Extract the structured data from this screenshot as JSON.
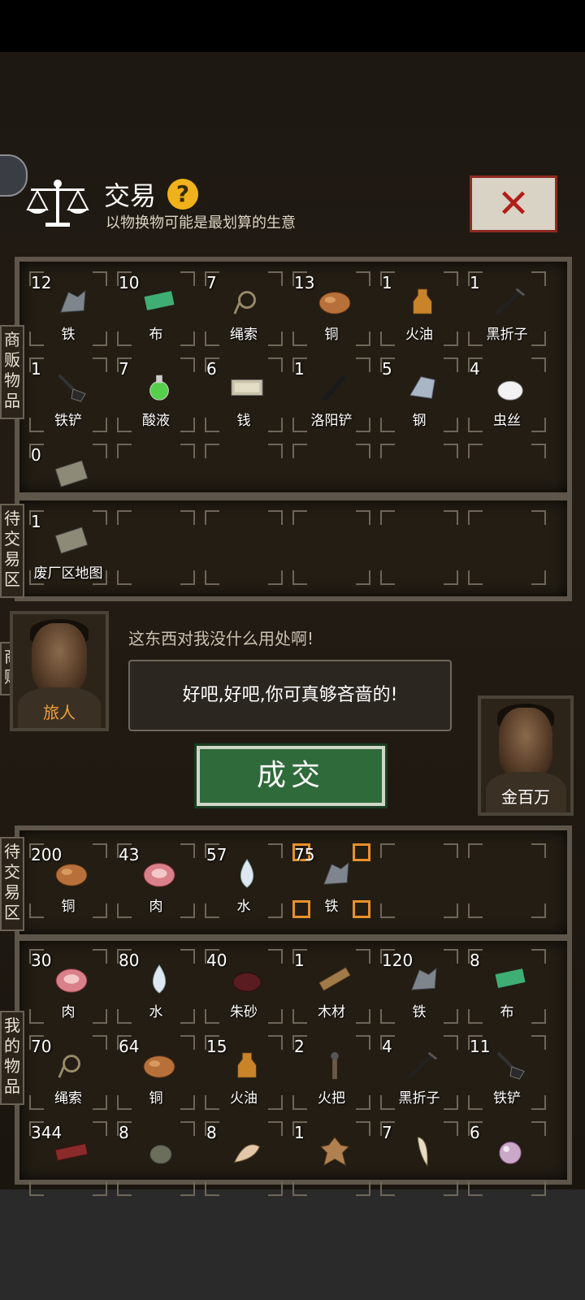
{
  "header": {
    "title": "交易",
    "help_label": "?",
    "subtitle": "以物换物可能是最划算的生意",
    "close_label": "✕"
  },
  "labels": {
    "merchant_goods": "商贩物品",
    "pending_trade_merchant": "待交易区",
    "merchant": "商贩",
    "pending_trade_mine": "待交易区",
    "my_goods": "我的物品"
  },
  "merchant_goods": [
    {
      "qty": "12",
      "name": "铁",
      "icon": "iron-ore-icon"
    },
    {
      "qty": "10",
      "name": "布",
      "icon": "cloth-icon"
    },
    {
      "qty": "7",
      "name": "绳索",
      "icon": "rope-icon"
    },
    {
      "qty": "13",
      "name": "铜",
      "icon": "copper-ore-icon"
    },
    {
      "qty": "1",
      "name": "火油",
      "icon": "kerosene-icon"
    },
    {
      "qty": "1",
      "name": "黑折子",
      "icon": "black-pick-icon"
    },
    {
      "qty": "1",
      "name": "铁铲",
      "icon": "shovel-icon"
    },
    {
      "qty": "7",
      "name": "酸液",
      "icon": "acid-flask-icon"
    },
    {
      "qty": "6",
      "name": "钱",
      "icon": "money-icon"
    },
    {
      "qty": "1",
      "name": "洛阳铲",
      "icon": "luoyang-shovel-icon"
    },
    {
      "qty": "5",
      "name": "钢",
      "icon": "steel-icon"
    },
    {
      "qty": "4",
      "name": "虫丝",
      "icon": "silk-bowl-icon"
    },
    {
      "qty": "0",
      "name": "",
      "icon": "map-icon"
    }
  ],
  "merchant_pending": [
    {
      "qty": "1",
      "name": "废厂区地图",
      "icon": "map-icon"
    }
  ],
  "traveler": {
    "name": "旅人",
    "line": "这东西对我没什么用处啊!"
  },
  "speech_bubble": "好吧,好吧,你可真够吝啬的!",
  "deal_button": "成交",
  "player": {
    "name": "金百万"
  },
  "my_pending": [
    {
      "qty": "200",
      "name": "铜",
      "icon": "copper-ore-icon"
    },
    {
      "qty": "43",
      "name": "肉",
      "icon": "meat-icon"
    },
    {
      "qty": "57",
      "name": "水",
      "icon": "water-drop-icon"
    },
    {
      "qty": "75",
      "name": "铁",
      "icon": "iron-ore-icon",
      "selected": true
    }
  ],
  "my_goods": [
    {
      "qty": "30",
      "name": "肉",
      "icon": "meat-icon"
    },
    {
      "qty": "80",
      "name": "水",
      "icon": "water-drop-icon"
    },
    {
      "qty": "40",
      "name": "朱砂",
      "icon": "cinnabar-icon"
    },
    {
      "qty": "1",
      "name": "木材",
      "icon": "wood-icon"
    },
    {
      "qty": "120",
      "name": "铁",
      "icon": "iron-ore-icon"
    },
    {
      "qty": "8",
      "name": "布",
      "icon": "cloth-icon"
    },
    {
      "qty": "70",
      "name": "绳索",
      "icon": "rope-icon"
    },
    {
      "qty": "64",
      "name": "铜",
      "icon": "copper-ore-icon"
    },
    {
      "qty": "15",
      "name": "火油",
      "icon": "kerosene-icon"
    },
    {
      "qty": "2",
      "name": "火把",
      "icon": "torch-icon"
    },
    {
      "qty": "4",
      "name": "黑折子",
      "icon": "black-pick-icon"
    },
    {
      "qty": "11",
      "name": "铁铲",
      "icon": "shovel-icon"
    },
    {
      "qty": "344",
      "name": "",
      "icon": "jerky-icon"
    },
    {
      "qty": "8",
      "name": "",
      "icon": "gourd-icon"
    },
    {
      "qty": "8",
      "name": "",
      "icon": "bone-icon"
    },
    {
      "qty": "1",
      "name": "",
      "icon": "hide-icon"
    },
    {
      "qty": "7",
      "name": "",
      "icon": "tooth-icon"
    },
    {
      "qty": "6",
      "name": "",
      "icon": "pearl-icon"
    }
  ]
}
